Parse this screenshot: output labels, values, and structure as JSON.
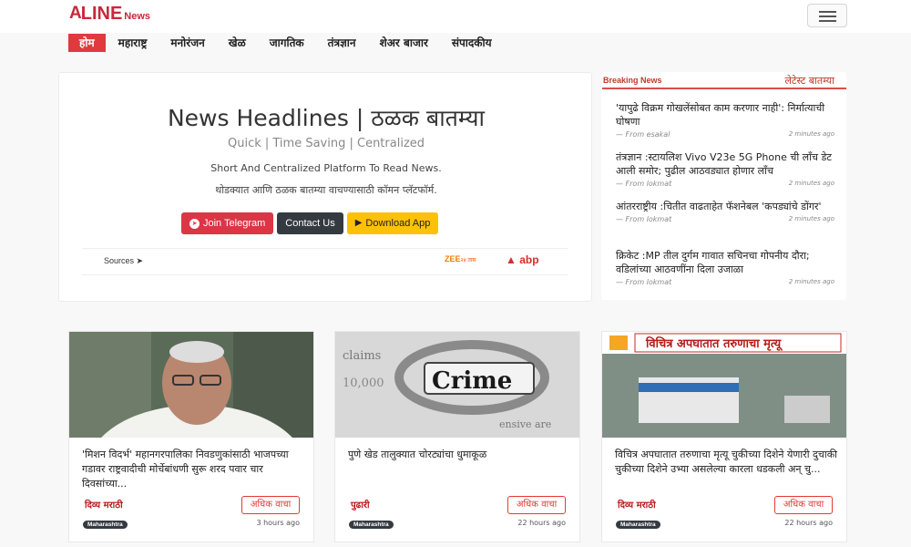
{
  "brand": {
    "mark": "A",
    "name": "LINE",
    "suffix": "News"
  },
  "nav": [
    {
      "label": "होम",
      "active": true
    },
    {
      "label": "महाराष्ट्र"
    },
    {
      "label": "मनोरंजन"
    },
    {
      "label": "खेळ"
    },
    {
      "label": "जागतिक"
    },
    {
      "label": "तंत्रज्ञान"
    },
    {
      "label": "शेअर बाजार"
    },
    {
      "label": "संपादकीय"
    }
  ],
  "hero": {
    "title": "News Headlines | ठळक बातम्या",
    "subtitle": "Quick | Time Saving | Centralized",
    "desc_en": "Short And Centralized Platform To Read News.",
    "desc_mr": "थोडक्यात आणि ठळक बातम्या वाचण्यासाठी कॉमन प्लॅटफॉर्म.",
    "buttons": {
      "telegram": "Join Telegram",
      "contact": "Contact Us",
      "download": "Download App"
    },
    "sources_label": "Sources ➤",
    "source_logos": {
      "zee": "ZEE",
      "zee_small": "२४ तास",
      "abp": "abp"
    }
  },
  "breaking": {
    "label": "Breaking News",
    "latest": "लेटेस्ट बातम्या",
    "items": [
      {
        "title": "'यापुढे विक्रम गोखलेंसोबत काम करणार नाही': निर्मात्याची घोषणा",
        "source": "— From esakal",
        "time": "2 minutes ago"
      },
      {
        "title": "तंत्रज्ञान :स्टायलिश Vivo V23e 5G Phone ची लाँच डेट आली समोर; पुढील आठवड्यात होणार लाँच",
        "source": "— From lokmat",
        "time": "2 minutes ago"
      },
      {
        "title": "आंतरराष्ट्रीय :चितीत वाढताहेत फॅशनेबल 'कपड्यांचे डोंगर'",
        "source": "— From lokmat",
        "time": "2 minutes ago"
      },
      {
        "title": "क्रिकेट :MP तील दुर्गम गावात सचिनचा गोपनीय दौरा; वडिलांच्या आठवणींना दिला उजाळा",
        "source": "— From lokmat",
        "time": "2 minutes ago"
      }
    ]
  },
  "cards": [
    {
      "title": "'मिशन विदर्भ' महानगरपालिका निवडणुकांसाठी भाजपच्या गडावर राष्ट्रवादीची मोर्चेबांधणी सुरू शरद पवार चार दिवसांच्या...",
      "source_logo": "दिव्य मराठी",
      "button": "अधिक वाचा",
      "badge": "Maharashtra",
      "time": "3 hours ago"
    },
    {
      "title": "पुणे खेड तालुक्यात चोरट्यांचा धुमाकूळ",
      "source_logo": "पुढारी",
      "button": "अधिक वाचा",
      "badge": "Maharashtra",
      "time": "22 hours ago",
      "image_text": "Crime"
    },
    {
      "title": "विचित्र अपघातात तरुणाचा मृत्यू चुकीच्या दिशेने येणारी दुचाकी चुकीच्या दिशेने उभ्या असलेल्या कारला धडकली अन् चु...",
      "source_logo": "दिव्य मराठी",
      "button": "अधिक वाचा",
      "badge": "Maharashtra",
      "time": "22 hours ago",
      "image_banner": "विचित्र अपघातात तरुणाचा मृत्यू"
    }
  ]
}
